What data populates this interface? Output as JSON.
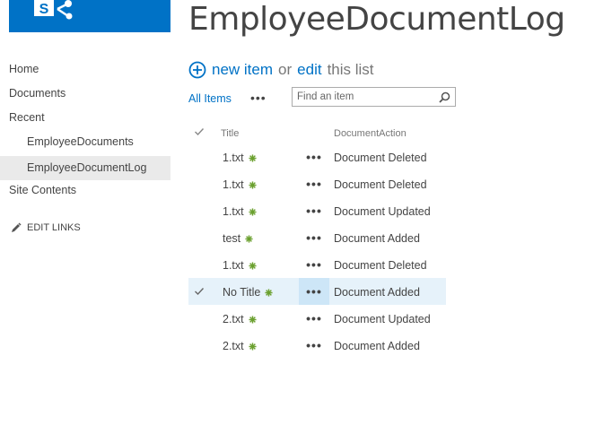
{
  "site": {
    "title": "EmployeeDocumentLog",
    "brand_color": "#0072c6"
  },
  "quicklaunch": {
    "items": [
      {
        "label": "Home",
        "level": 0,
        "selected": false
      },
      {
        "label": "Documents",
        "level": 0,
        "selected": false
      },
      {
        "label": "Recent",
        "level": 0,
        "selected": false
      },
      {
        "label": "EmployeeDocuments",
        "level": 1,
        "selected": false
      },
      {
        "label": "EmployeeDocumentLog",
        "level": 1,
        "selected": true
      },
      {
        "label": "Site Contents",
        "level": 0,
        "selected": false
      }
    ],
    "edit_links_label": "EDIT LINKS",
    "edit_links_icon": "pencil-icon"
  },
  "toolbar": {
    "new_item_label": "new item",
    "or_label": "or",
    "edit_label": "edit",
    "this_list_label": "this list",
    "add_icon": "plus-circle-icon"
  },
  "views": {
    "current_view": "All Items",
    "more_label": "•••",
    "search_placeholder": "Find an item",
    "search_icon": "magnifier-icon"
  },
  "list": {
    "columns": {
      "title": "Title",
      "action": "DocumentAction"
    },
    "row_menu_label": "•••",
    "new_badge_icon": "new-badge-icon",
    "new_badge_color": "#6ba02f",
    "selected_row_color": "#e6f2fa",
    "rows": [
      {
        "title": "1.txt",
        "action": "Document Deleted",
        "selected": false
      },
      {
        "title": "1.txt",
        "action": "Document Deleted",
        "selected": false
      },
      {
        "title": "1.txt",
        "action": "Document Updated",
        "selected": false
      },
      {
        "title": "test",
        "action": "Document Added",
        "selected": false
      },
      {
        "title": "1.txt",
        "action": "Document Deleted",
        "selected": false
      },
      {
        "title": "No Title",
        "action": "Document Added",
        "selected": true
      },
      {
        "title": "2.txt",
        "action": "Document Updated",
        "selected": false
      },
      {
        "title": "2.txt",
        "action": "Document Added",
        "selected": false
      }
    ]
  }
}
